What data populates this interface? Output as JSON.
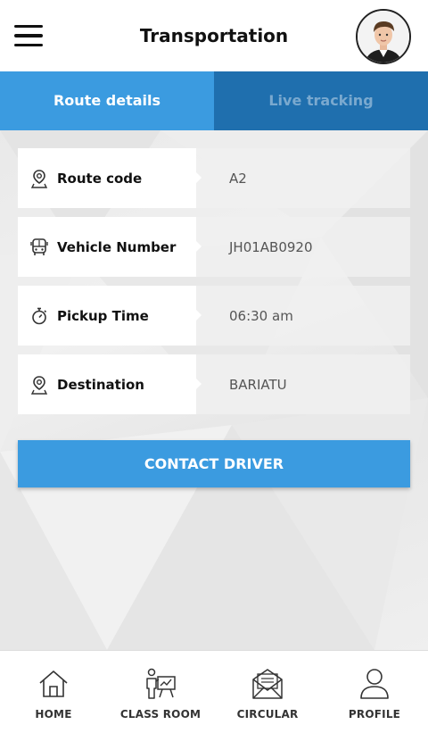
{
  "header": {
    "title": "Transportation",
    "menu_icon": "hamburger-menu-icon",
    "avatar_icon": "user-avatar"
  },
  "tabs": [
    {
      "label": "Route details",
      "active": true
    },
    {
      "label": "Live tracking",
      "active": false
    }
  ],
  "details": [
    {
      "icon": "location-pin-icon",
      "label": "Route code",
      "value": "A2"
    },
    {
      "icon": "bus-icon",
      "label": "Vehicle Number",
      "value": "JH01AB0920"
    },
    {
      "icon": "stopwatch-icon",
      "label": "Pickup Time",
      "value": "06:30 am"
    },
    {
      "icon": "location-pin-icon",
      "label": "Destination",
      "value": "BARIATU"
    }
  ],
  "contact_button": {
    "label": "CONTACT DRIVER"
  },
  "bottom_nav": [
    {
      "icon": "home-icon",
      "label": "HOME"
    },
    {
      "icon": "classroom-icon",
      "label": "CLASS ROOM"
    },
    {
      "icon": "envelope-icon",
      "label": "CIRCULAR"
    },
    {
      "icon": "profile-icon",
      "label": "PROFILE"
    }
  ],
  "colors": {
    "accent": "#3b9be0",
    "tab_inactive": "#1f6fae",
    "background": "#ececec"
  }
}
